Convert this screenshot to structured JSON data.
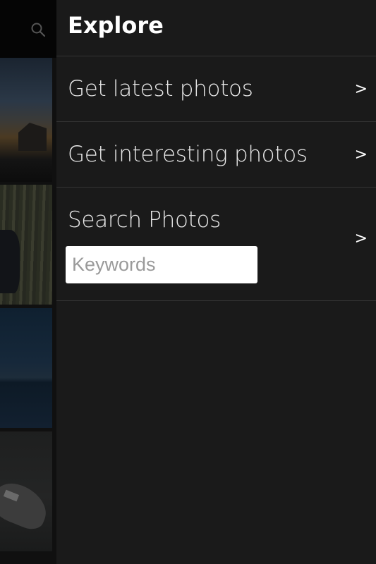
{
  "drawer": {
    "title": "Explore",
    "items": [
      {
        "label": "Get latest photos",
        "chevron": ">"
      },
      {
        "label": "Get interesting photos",
        "chevron": ">"
      }
    ],
    "search": {
      "label": "Search Photos",
      "chevron": ">",
      "input_placeholder": "Keywords",
      "input_value": ""
    }
  },
  "background": {
    "icon": "search-icon",
    "thumbnails": [
      "sunset-photo",
      "forest-portrait-photo",
      "sea-photo",
      "boat-photo"
    ]
  },
  "colors": {
    "drawer_bg": "#1a1a1a",
    "divider": "#333333",
    "text": "#e8e8e8",
    "title": "#ffffff"
  }
}
